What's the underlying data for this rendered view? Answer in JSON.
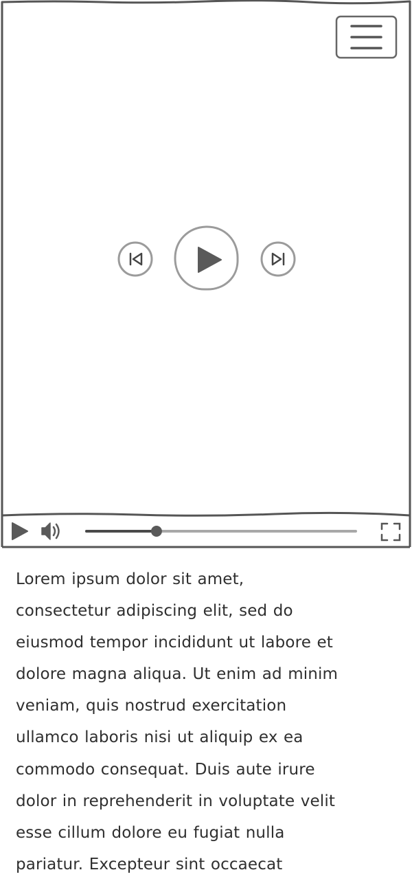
{
  "icons": {
    "menu": "hamburger-menu-icon",
    "previous": "skip-previous-icon",
    "play": "play-icon",
    "next": "skip-next-icon",
    "play_small": "play-icon",
    "volume": "speaker-volume-icon",
    "fullscreen": "fullscreen-icon"
  },
  "colors": {
    "stroke": "#555555",
    "icon_fill": "#5a5a5a",
    "track_played": "#4a4a4a",
    "track_rest": "#a8a8a8",
    "circle_outline": "#9b9b9b",
    "text": "#2f2f2f"
  },
  "player": {
    "progress": 0.26
  },
  "description": {
    "text": "Lorem ipsum dolor sit amet,\nconsectetur adipiscing elit, sed do\neiusmod tempor incididunt ut labore et\ndolore magna aliqua. Ut enim ad minim\nveniam, quis nostrud exercitation\nullamco laboris nisi ut aliquip ex ea\ncommodo consequat. Duis aute irure\ndolor in reprehenderit in voluptate velit\nesse cillum dolore eu fugiat nulla\npariatur. Excepteur sint occaecat"
  }
}
